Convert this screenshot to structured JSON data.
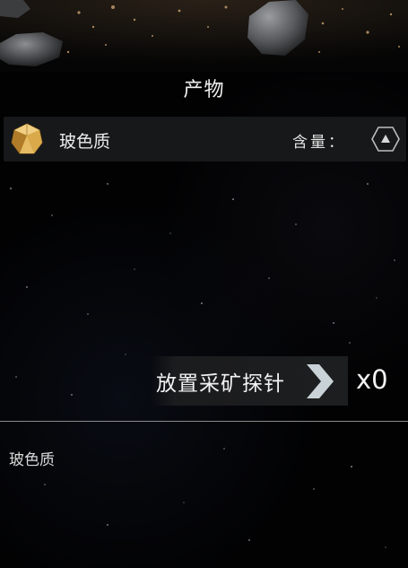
{
  "panel": {
    "title": "产物"
  },
  "resource": {
    "name": "玻色质",
    "content_label": "含量：",
    "gem_icon": "gem-icon",
    "content_indicator_icon": "hexagon-triangle-icon"
  },
  "probe": {
    "label": "放置采矿探针",
    "count": "x0",
    "action_icon": "chevron-right-icon"
  },
  "description": {
    "text": "玻色质"
  },
  "colors": {
    "background": "#020203",
    "row_background": "#17181a",
    "button_background": "#1d1e20",
    "divider": "#8a8a8a",
    "gem_gold": "#d9a94a",
    "chevron": "#c9d2d6"
  }
}
